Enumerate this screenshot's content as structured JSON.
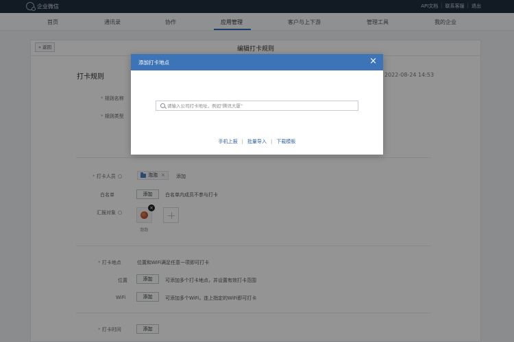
{
  "app": {
    "brand": "企业微信"
  },
  "top_links": [
    "API文档",
    "联系客服",
    "退出"
  ],
  "nav": {
    "items": [
      "首页",
      "通讯录",
      "协作",
      "应用管理",
      "客户与上下游",
      "管理工具",
      "我的企业"
    ],
    "active_index": 3
  },
  "panel": {
    "back_label": "返回",
    "title": "编辑打卡规则",
    "section_title": "打卡规则",
    "time": "2022-08-24 14:53"
  },
  "form": {
    "rule_name_label": "规则名称",
    "rule_type_label": "规则类型",
    "members_label": "打卡人员",
    "members_tag": "泡泡",
    "members_add": "添加",
    "whitelist_label": "白名单",
    "whitelist_btn": "添加",
    "whitelist_hint": "白名单内成员不参与打卡",
    "report_label": "汇报对象",
    "report_name": "泡泡",
    "location_label": "打卡地点",
    "location_hint": "位置和WiFi满足任意一项即可打卡",
    "position_label": "位置",
    "position_btn": "添加",
    "position_hint": "可添加多个打卡地点，并设置有效打卡范围",
    "wifi_label": "WiFi",
    "wifi_btn": "添加",
    "wifi_hint": "可添加多个WiFi，连上指定的WiFi即可打卡",
    "time_label": "打卡时间",
    "time_btn": "添加"
  },
  "modal": {
    "title": "添加打卡地点",
    "close": "×",
    "search_placeholder": "请输入公司打卡地址，例如\"腾讯大厦\"",
    "search_value": "",
    "links": [
      "手机上报",
      "批量导入",
      "下载模板"
    ],
    "link_sep": "|"
  },
  "colors": {
    "topbar": "#1f2e3f",
    "modal_header": "#3d74b8",
    "link": "#2e5f9f",
    "nav_active_underline": "#2d6cb5"
  },
  "icons": [
    "brand-logo-icon",
    "search-icon",
    "close-icon",
    "folder-icon",
    "help-icon",
    "plus-icon",
    "avatar-delete-icon"
  ]
}
